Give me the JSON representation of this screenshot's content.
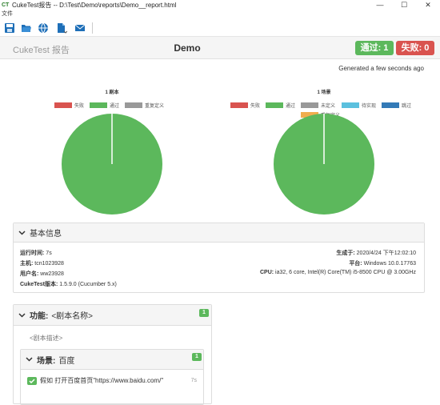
{
  "window": {
    "app_icon": "CT",
    "title": "CukeTest报告 -- D:\\Test\\Demo\\reports\\Demo__report.html",
    "minimize": "—",
    "maximize": "☐",
    "close": "✕"
  },
  "menu": {
    "file": "文件"
  },
  "toolbar": {
    "icons": [
      "save-icon",
      "folder-open-icon",
      "globe-icon",
      "export-file-icon",
      "email-icon"
    ]
  },
  "header": {
    "brand": "CukeTest 报告",
    "title": "Demo",
    "pass_label": "通过: 1",
    "fail_label": "失败: 0"
  },
  "generated": "Generated a few seconds ago",
  "charts": {
    "scripts": {
      "title": "1 剧本",
      "legend": [
        "失败",
        "通过",
        "重复定义"
      ]
    },
    "scenarios": {
      "title": "1 场景",
      "legend": [
        "失败",
        "通过",
        "未定义",
        "待实现",
        "跳过",
        "重复定义"
      ]
    }
  },
  "chart_data": [
    {
      "type": "pie",
      "title": "1 剧本",
      "categories": [
        "失败",
        "通过",
        "重复定义"
      ],
      "values": [
        0,
        1,
        0
      ],
      "colors": [
        "#d9534f",
        "#5cb85c",
        "#999999"
      ]
    },
    {
      "type": "pie",
      "title": "1 场景",
      "categories": [
        "失败",
        "通过",
        "未定义",
        "待实现",
        "跳过",
        "重复定义"
      ],
      "values": [
        0,
        1,
        0,
        0,
        0,
        0
      ],
      "colors": [
        "#d9534f",
        "#5cb85c",
        "#999999",
        "#5bc0de",
        "#337ab7",
        "#f0ad4e"
      ]
    }
  ],
  "info": {
    "heading": "基本信息",
    "runtime_label": "运行时间:",
    "runtime_value": "7s",
    "host_label": "主机:",
    "host_value": "tcn1023928",
    "user_label": "用户名:",
    "user_value": "ww23928",
    "version_label": "CukeTest版本:",
    "version_value": "1.5.9.0 (Cucumber 5.x)",
    "generated_label": "生成于:",
    "generated_value": "2020/4/24 下午12:02:10",
    "platform_label": "平台:",
    "platform_value": "Windows 10.0.17763",
    "cpu_label": "CPU:",
    "cpu_value": "ia32, 6 core, Intel(R) Core(TM) i5-8500 CPU @ 3.00GHz"
  },
  "feature": {
    "label": "功能:",
    "name": "<剧本名称>",
    "count": "1",
    "description": "<剧本描述>"
  },
  "scenario": {
    "label": "场景:",
    "name": "百度",
    "count": "1"
  },
  "step": {
    "text": "假如 打开百度首页\"https://www.baidu.com/\"",
    "duration": "7s"
  },
  "colors": {
    "pass": "#5cb85c",
    "fail": "#d9534f",
    "undefined": "#999999",
    "pending": "#5bc0de",
    "skipped": "#337ab7",
    "ambiguous": "#f0ad4e"
  }
}
